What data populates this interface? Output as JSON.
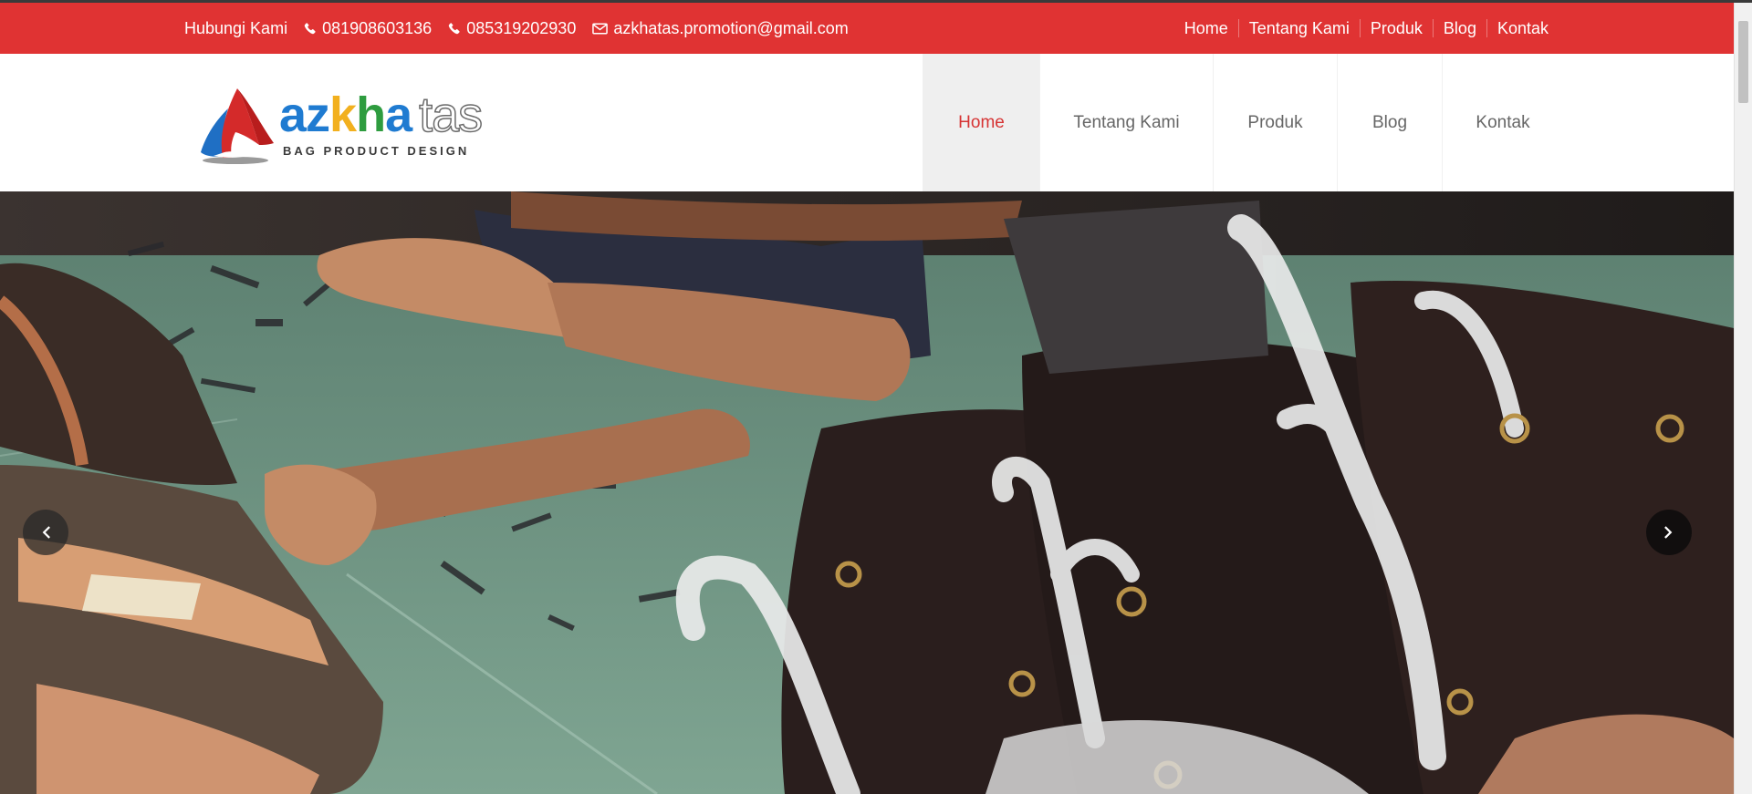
{
  "topbar": {
    "contact_label": "Hubungi Kami",
    "phone_1": "081908603136",
    "phone_2": "085319202930",
    "email": "azkhatas.promotion@gmail.com",
    "nav": [
      "Home",
      "Tentang Kami",
      "Produk",
      "Blog",
      "Kontak"
    ]
  },
  "logo": {
    "word_a": "a",
    "word_z": "z",
    "word_k": "k",
    "word_h": "h",
    "word_a2": "a",
    "word_tas": "tas",
    "tagline": "BAG PRODUCT DESIGN"
  },
  "main_nav": {
    "items": [
      "Home",
      "Tentang Kami",
      "Produk",
      "Blog",
      "Kontak"
    ],
    "active": "Home"
  },
  "slider": {
    "prev_icon": "chevron-left-icon",
    "next_icon": "chevron-right-icon"
  },
  "colors": {
    "brand_red": "#e03333",
    "active_link": "#d63333",
    "nav_text": "#666666"
  }
}
